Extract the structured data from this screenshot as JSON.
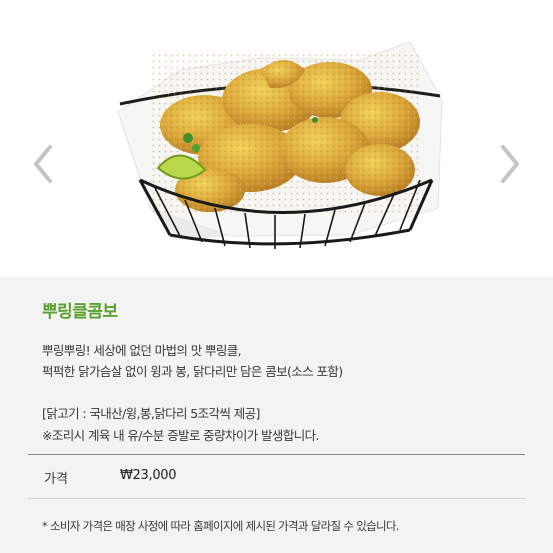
{
  "product": {
    "name": "뿌링클콤보",
    "description": [
      "뿌링뿌링! 세상에 없던 마법의 맛 뿌링클,",
      "퍽퍽한 닭가슴살 없이 윙과 봉, 닭다리만 담은 콤보(소스 포함)",
      "",
      "[닭고기 : 국내산/윙,봉,닭다리 5조각씩 제공]",
      "※조리시 계육 내 유/수분 증발로 중량차이가 발생합니다."
    ],
    "price_label": "가격",
    "price_value": "₩23,000",
    "notice": "* 소비자 가격은 매장 사정에 따라 홈페이지에 제시된 가격과 달라질 수 있습니다."
  },
  "icons": {
    "prev": "chevron-left-icon",
    "next": "chevron-right-icon"
  },
  "colors": {
    "accent": "#5aa02c",
    "panel": "#f3f3f3"
  }
}
